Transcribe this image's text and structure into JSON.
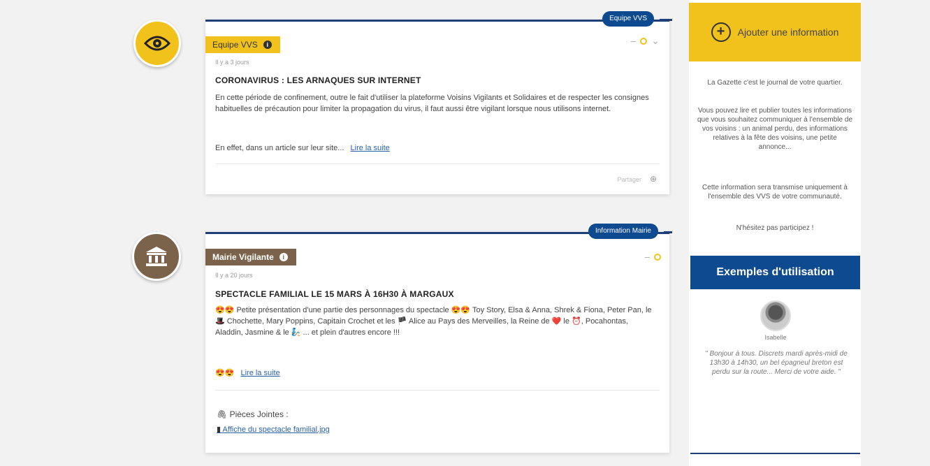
{
  "feed": [
    {
      "badge": "Equipe VVS",
      "tag": "Equipe VVS",
      "date": "Il y a 3 jours",
      "title": "CORONAVIRUS : LES ARNAQUES SUR INTERNET",
      "body": "En cette période de confinement, outre le fait d'utiliser la plateforme Voisins Vigilants et Solidaires et de respecter les consignes habituelles de précaution pour limiter la propagation du virus, il faut aussi être vigilant lorsque nous utilisons internet.",
      "excerpt": "En effet, dans un article sur leur site...",
      "read_more": "Lire la suite",
      "footer": "Partager"
    },
    {
      "badge": "Information Mairie",
      "tag": "Mairie Vigilante",
      "date": "Il y a 20 jours",
      "title": "SPECTACLE FAMILIAL LE 15 MARS À 16H30 À MARGAUX",
      "body": "😍😍 Petite présentation d'une partie des personnages du spectacle 😍😍 Toy Story, Elsa & Anna, Shrek & Fiona, Peter Pan, le 🎩 Chochette, Mary Poppins, Capitain Crochet et les 🏴 Alice au Pays des Merveilles, la Reine de ❤️ le ⏰, Pocahontas, Aladdin, Jasmine & le 🧞 ... et plein d'autres encore !!!",
      "excerpt": "😍😍",
      "read_more": "Lire la suite",
      "attachments_title": "Pièces Jointes :",
      "attachment": "Affiche du spectacle familial.jpg"
    }
  ],
  "sidebar": {
    "add_label": "Ajouter une information",
    "p1": "La Gazette c'est le journal de votre quartier.",
    "p2": "Vous pouvez lire et publier toutes les informations que vous souhaitez communiquer à l'ensemble de vos voisins : un animal perdu, des informations relatives à la fête des voisins, une petite annonce...",
    "p3": "Cette information sera transmise uniquement à l'ensemble des VVS de votre communauté.",
    "p4": "N'hésitez pas participez !",
    "examples_title": "Exemples d'utilisation",
    "user_name": "Isabelle",
    "quote": "\" Bonjour à tous. Discrets mardi après-midi de 13h30 à 14h30, un bel épagneul breton est perdu sur la route... Merci de votre aide. \""
  },
  "colors": {
    "accent_yellow": "#f2c21c",
    "navy": "#0e4a90",
    "brown": "#7a634a"
  }
}
